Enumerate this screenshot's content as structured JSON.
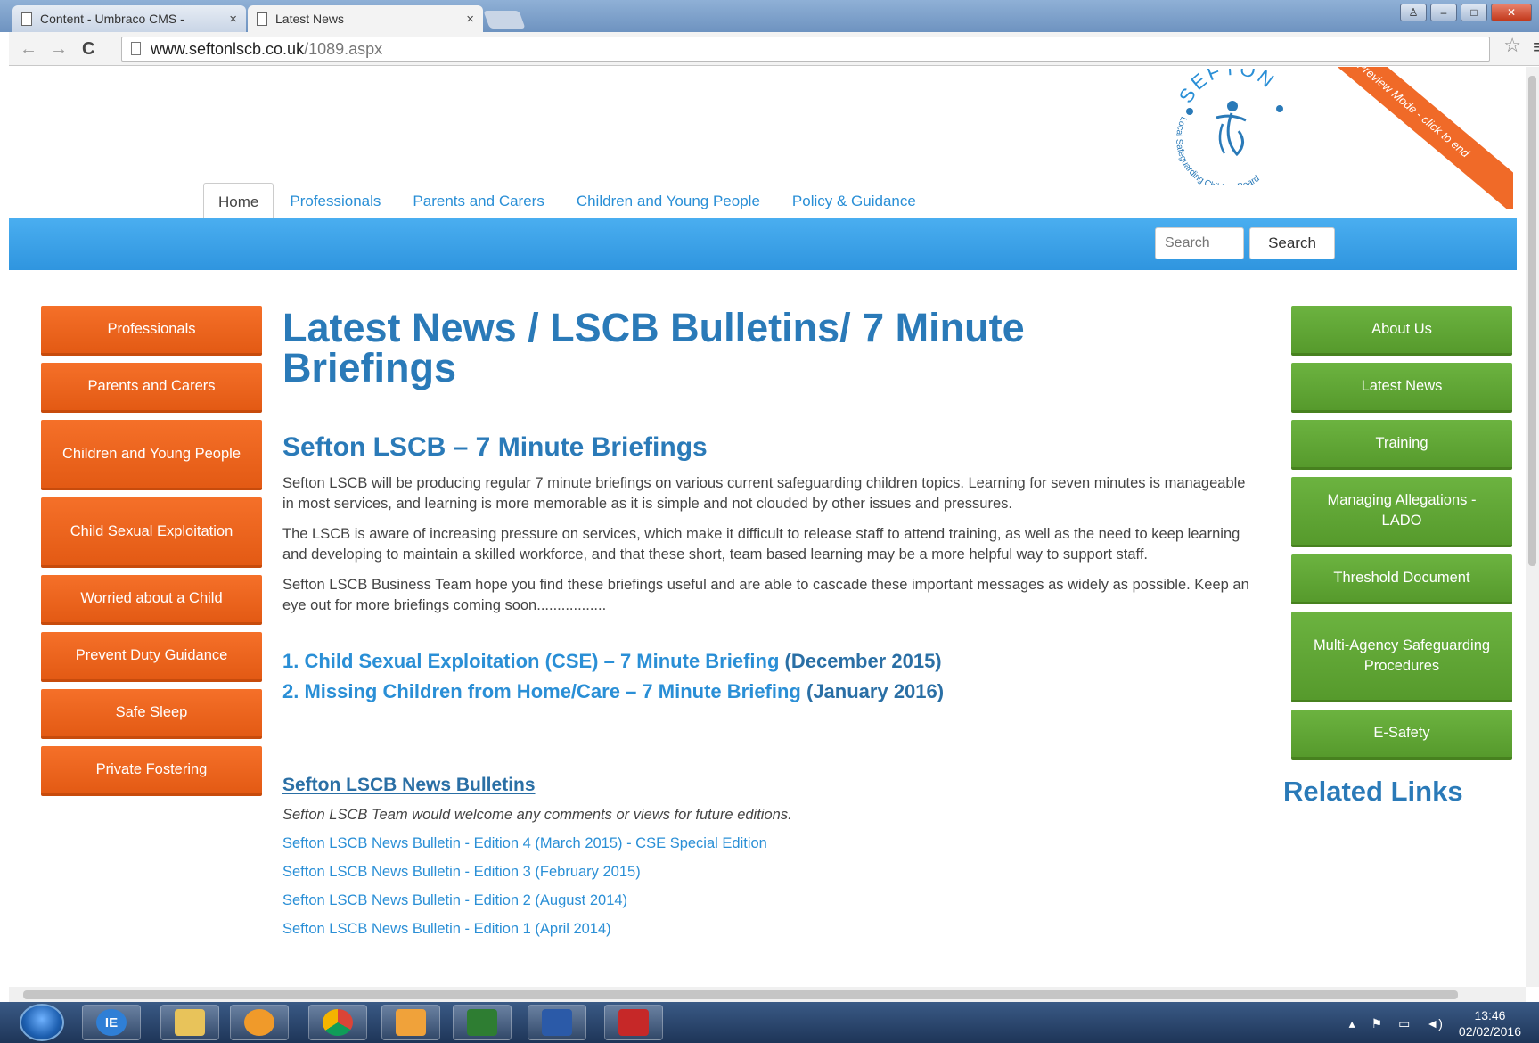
{
  "browser": {
    "tabs": [
      {
        "title": "Content - Umbraco CMS -",
        "close": "×"
      },
      {
        "title": "Latest News",
        "close": "×"
      }
    ],
    "url_host": "www.seftonlscb.co.uk",
    "url_path": "/1089.aspx",
    "back": "←",
    "forward": "→",
    "reload": "C",
    "star": "☆",
    "menu": "≡",
    "window_controls": {
      "user": "♙",
      "minimize": "‒",
      "maximize": "□",
      "close": "✕"
    }
  },
  "header": {
    "logo_text_top": "SEFTON",
    "logo_text_left": "Local Safeguarding Children Board",
    "ribbon": "Preview Mode - click to end",
    "topnav": [
      "Home",
      "Professionals",
      "Parents and Carers",
      "Children and Young People",
      "Policy & Guidance"
    ],
    "search_placeholder": "Search",
    "search_button": "Search"
  },
  "leftnav": [
    "Professionals",
    "Parents and Carers",
    "Children and Young People",
    "Child Sexual Exploitation",
    "Worried about a Child",
    "Prevent Duty Guidance",
    "Safe Sleep",
    "Private Fostering"
  ],
  "rightnav": [
    "About Us",
    "Latest News",
    "Training",
    "Managing Allegations - LADO",
    "Threshold Document",
    "Multi-Agency Safeguarding Procedures",
    "E-Safety"
  ],
  "related_links": "Related Links",
  "main": {
    "title": "Latest News / LSCB Bulletins/ 7 Minute Briefings",
    "section_title": "Sefton LSCB – 7 Minute Briefings",
    "paragraphs": [
      "Sefton LSCB will be producing regular 7 minute briefings on various current safeguarding children topics.  Learning for seven minutes is manageable in most services, and learning is more memorable as it is simple and not clouded by other issues and pressures.",
      "The LSCB is aware of increasing pressure on services, which make it difficult to release staff to attend training, as well as the need to keep learning and developing to maintain a skilled workforce, and that these short, team based learning may be a more helpful way to support staff.",
      "Sefton LSCB Business Team hope you find these briefings useful and are able to cascade these important messages as widely as possible.  Keep an eye out for more briefings coming soon................."
    ],
    "briefings": [
      {
        "link": "1. Child Sexual Exploitation (CSE) – 7 Minute Briefing",
        "date": "(December 2015)"
      },
      {
        "link": "2. Missing Children from Home/Care – 7 Minute Briefing",
        "date": "(January 2016)"
      }
    ],
    "bulletins_title": "Sefton LSCB News Bulletins",
    "bulletins_note": "Sefton LSCB Team would welcome any comments or views for future editions.",
    "bulletins": [
      "Sefton LSCB News Bulletin - Edition 4 (March 2015) - CSE Special Edition",
      "Sefton LSCB News Bulletin - Edition 3 (February 2015)",
      "Sefton LSCB News Bulletin - Edition 2 (August 2014)",
      "Sefton LSCB News Bulletin - Edition 1 (April 2014)"
    ]
  },
  "taskbar": {
    "apps": [
      "IE",
      "Explorer",
      "Media",
      "Chrome",
      "Outlook",
      "Excel",
      "Word",
      "Acrobat"
    ],
    "time": "13:46",
    "date": "02/02/2016"
  },
  "colors": {
    "orange": "#f06a28",
    "green": "#63a83a",
    "blue": "#2f95df",
    "title_blue": "#2a7ab8"
  }
}
